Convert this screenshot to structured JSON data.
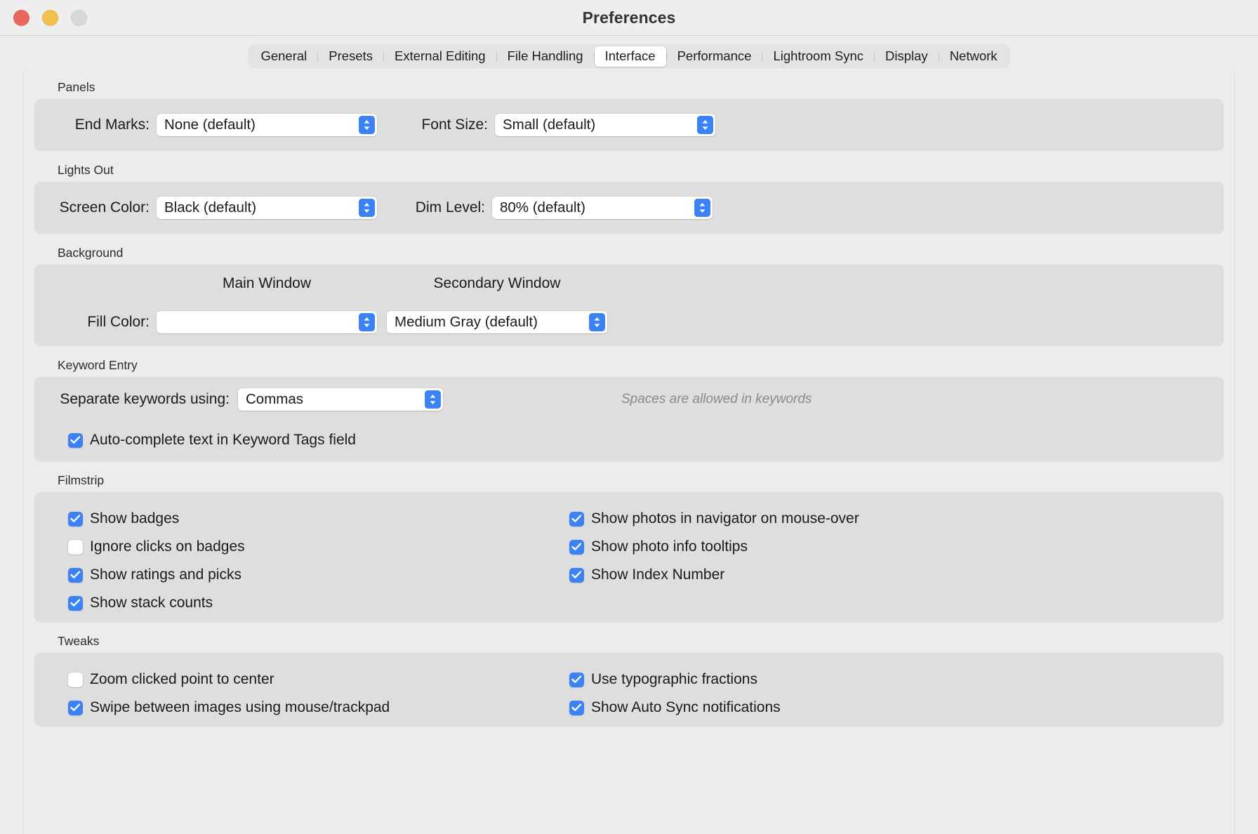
{
  "window": {
    "title": "Preferences",
    "controls": [
      {
        "name": "close",
        "color": "#e8695c"
      },
      {
        "name": "minimize",
        "color": "#f3bf4f"
      },
      {
        "name": "zoom",
        "color": "#d8d8d8"
      }
    ]
  },
  "tabs": [
    {
      "id": "general",
      "label": "General",
      "active": false
    },
    {
      "id": "presets",
      "label": "Presets",
      "active": false
    },
    {
      "id": "external-editing",
      "label": "External Editing",
      "active": false
    },
    {
      "id": "file-handling",
      "label": "File Handling",
      "active": false
    },
    {
      "id": "interface",
      "label": "Interface",
      "active": true
    },
    {
      "id": "performance",
      "label": "Performance",
      "active": false
    },
    {
      "id": "lightroom-sync",
      "label": "Lightroom Sync",
      "active": false
    },
    {
      "id": "display",
      "label": "Display",
      "active": false
    },
    {
      "id": "network",
      "label": "Network",
      "active": false
    }
  ],
  "panels_section": {
    "title": "Panels",
    "end_marks_label": "End Marks:",
    "end_marks_value": "None (default)",
    "font_size_label": "Font Size:",
    "font_size_value": "Small (default)"
  },
  "lights_out_section": {
    "title": "Lights Out",
    "screen_color_label": "Screen Color:",
    "screen_color_value": "Black (default)",
    "dim_level_label": "Dim Level:",
    "dim_level_value": "80% (default)"
  },
  "background_section": {
    "title": "Background",
    "main_window_header": "Main Window",
    "secondary_window_header": "Secondary Window",
    "fill_color_label": "Fill Color:",
    "main_window_value": "",
    "secondary_window_value": "Medium Gray (default)"
  },
  "keyword_entry_section": {
    "title": "Keyword Entry",
    "separator_label": "Separate keywords using:",
    "separator_value": "Commas",
    "hint": "Spaces are allowed in keywords",
    "autocomplete_label": "Auto-complete text in Keyword Tags field",
    "autocomplete_checked": true
  },
  "filmstrip_section": {
    "title": "Filmstrip",
    "left_items": [
      {
        "label": "Show badges",
        "checked": true
      },
      {
        "label": "Ignore clicks on badges",
        "checked": false
      },
      {
        "label": "Show ratings and picks",
        "checked": true
      },
      {
        "label": "Show stack counts",
        "checked": true
      }
    ],
    "right_items": [
      {
        "label": "Show photos in navigator on mouse-over",
        "checked": true
      },
      {
        "label": "Show photo info tooltips",
        "checked": true
      },
      {
        "label": "Show Index Number",
        "checked": true
      }
    ]
  },
  "tweaks_section": {
    "title": "Tweaks",
    "left_items": [
      {
        "label": "Zoom clicked point to center",
        "checked": false
      },
      {
        "label": "Swipe between images using mouse/trackpad",
        "checked": true
      }
    ],
    "right_items": [
      {
        "label": "Use typographic fractions",
        "checked": true
      },
      {
        "label": "Show Auto Sync notifications",
        "checked": true
      }
    ]
  },
  "colors": {
    "accent": "#3b82f6",
    "window_bg": "#ececec",
    "panel_bg": "#dedede",
    "titlebar_bg": "#eeeeee"
  }
}
